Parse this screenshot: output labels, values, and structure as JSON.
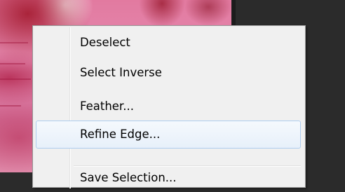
{
  "context_menu": {
    "items": [
      {
        "label": "Deselect",
        "highlighted": false
      },
      {
        "label": "Select Inverse",
        "highlighted": false
      },
      {
        "label": "Feather...",
        "highlighted": false
      },
      {
        "label": "Refine Edge...",
        "highlighted": true
      },
      {
        "label": "Save Selection...",
        "highlighted": false
      }
    ]
  },
  "colors": {
    "menu_background": "#f0f0f0",
    "menu_border": "#979797",
    "highlight_border": "#aeccee",
    "highlight_fill": "#e7f0fa",
    "dark_panel": "#2b2b2b",
    "canvas_pink": "#e58ab0"
  }
}
